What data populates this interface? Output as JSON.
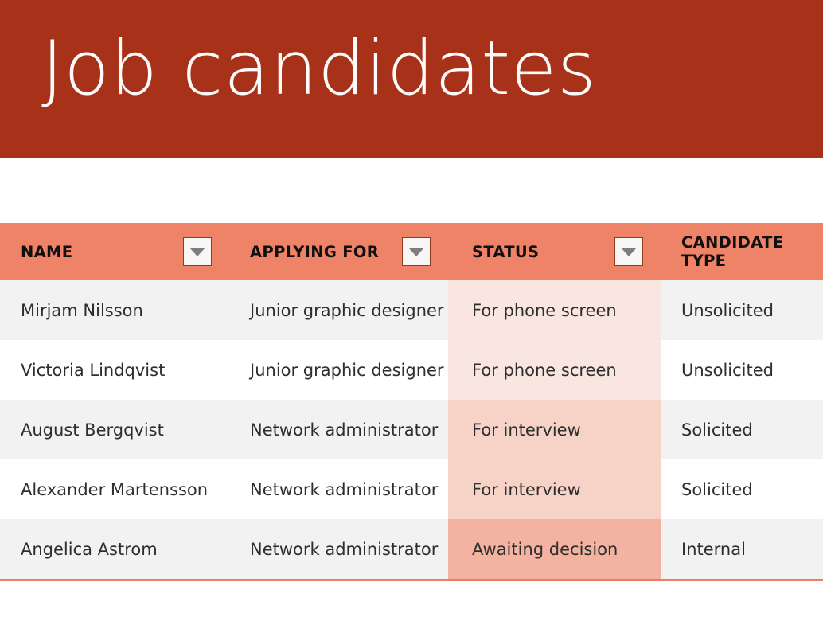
{
  "slide": {
    "title": "Job candidates",
    "banner_color": "#a83219",
    "title_color": "#fdfcfb"
  },
  "table": {
    "header_color": "#ee8368",
    "bottom_rule_color": "#ea7f62",
    "columns": [
      {
        "label": "NAME",
        "has_filter": true,
        "filter_icon": "chevron-down-icon"
      },
      {
        "label": "APPLYING FOR",
        "has_filter": true,
        "filter_icon": "chevron-down-icon"
      },
      {
        "label": "STATUS",
        "has_filter": true,
        "filter_icon": "chevron-down-icon"
      },
      {
        "label": "CANDIDATE TYPE",
        "has_filter": false,
        "filter_icon": ""
      }
    ],
    "rows": [
      {
        "name": "Mirjam Nilsson",
        "applying_for": "Junior graphic designer",
        "status": "For phone screen",
        "candidate_type": "Unsolicited",
        "row_shade": "shade-alt",
        "status_heat": "heat-1"
      },
      {
        "name": "Victoria Lindqvist",
        "applying_for": "Junior graphic designer",
        "status": "For phone screen",
        "candidate_type": "Unsolicited",
        "row_shade": "shade-plain",
        "status_heat": "heat-1"
      },
      {
        "name": "August Bergqvist",
        "applying_for": "Network administrator",
        "status": "For interview",
        "candidate_type": "Solicited",
        "row_shade": "shade-alt",
        "status_heat": "heat-2"
      },
      {
        "name": "Alexander Martensson",
        "applying_for": "Network administrator",
        "status": "For interview",
        "candidate_type": "Solicited",
        "row_shade": "shade-plain",
        "status_heat": "heat-2"
      },
      {
        "name": "Angelica Astrom",
        "applying_for": "Network administrator",
        "status": "Awaiting decision",
        "candidate_type": "Internal",
        "row_shade": "shade-alt",
        "status_heat": "heat-3"
      }
    ]
  }
}
